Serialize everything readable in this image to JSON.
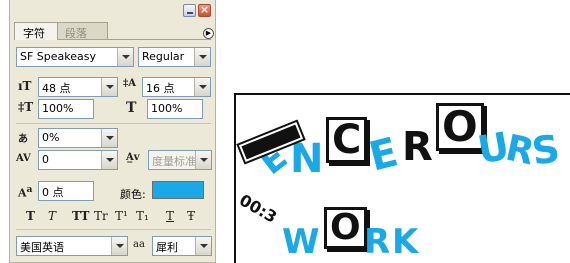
{
  "panel": {
    "tabs": [
      {
        "label": "字符",
        "active": true
      },
      {
        "label": "段落",
        "active": false
      }
    ],
    "font_family": "SF Speakeasy",
    "font_style": "Regular",
    "font_size": "48 点",
    "leading": "16 点",
    "vertical_scale": "100%",
    "horizontal_scale": "100%",
    "tsume": "0%",
    "kerning": "0",
    "tracking": "度量标准",
    "baseline_shift": "0 点",
    "color_label": "颜色:",
    "color_value": "#1aa8e6",
    "language": "美国英语",
    "antialias_icon_text": "aa",
    "antialias": "犀利",
    "style_buttons": [
      "T",
      "T",
      "TT",
      "Tr",
      "T¹",
      "T₁",
      "T",
      "Ŧ"
    ],
    "icons": {
      "size": "font-size-icon",
      "leading": "leading-icon",
      "vscale": "vertical-scale-icon",
      "hscale": "horizontal-scale-icon",
      "tsume": "tsume-icon",
      "kerning": "kerning-icon",
      "tracking": "tracking-icon",
      "baseline": "baseline-shift-icon",
      "menu": "panel-menu-icon"
    }
  },
  "artwork": {
    "line1": [
      "E",
      "N",
      "C",
      "E",
      "R",
      "O",
      "U",
      "R",
      "S"
    ],
    "prefix": "00:3",
    "line2": [
      "W",
      "O",
      "R",
      "K"
    ],
    "accent_color": "#1aa8e6",
    "ink_color": "#111111"
  }
}
